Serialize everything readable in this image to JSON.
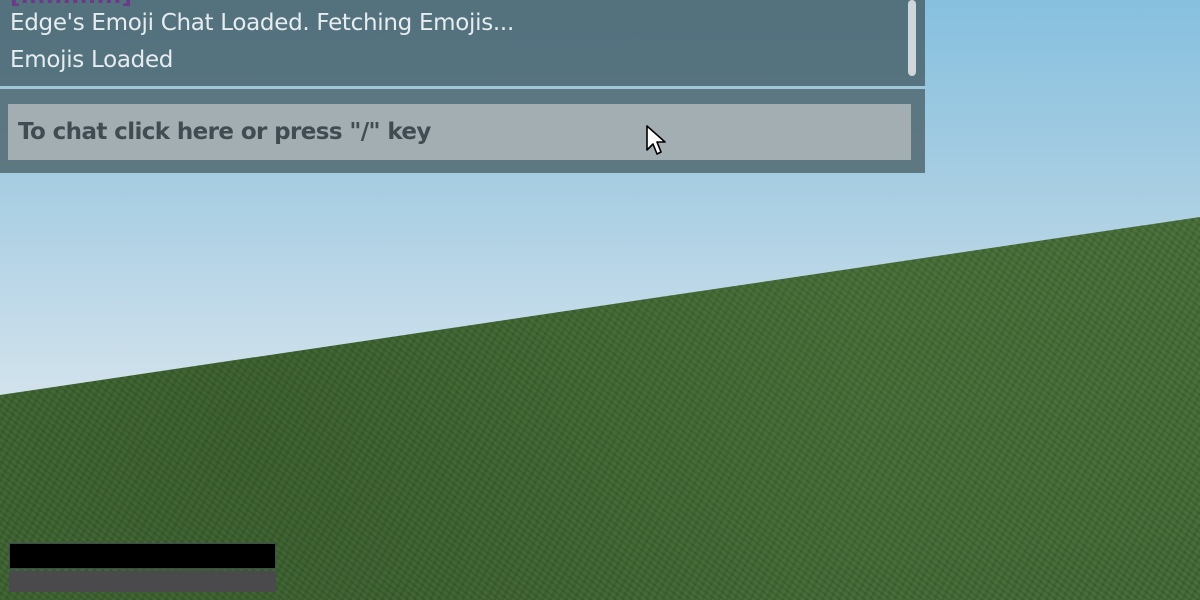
{
  "chat": {
    "partial_top_line": "[............]",
    "messages": [
      "Edge's Emoji Chat Loaded. Fetching Emojis...",
      "Emojis Loaded"
    ],
    "input_placeholder": "To chat click here or press \"/\" key"
  },
  "colors": {
    "chat_text": "#e6ecef",
    "username_purple": "#6b3a8a",
    "divider_blue": "#9fc7da",
    "input_background": "#a3aeb2",
    "sky_top": "#86c0df",
    "ground": "#436a34"
  },
  "icons": {
    "cursor": "mouse-pointer-icon"
  }
}
